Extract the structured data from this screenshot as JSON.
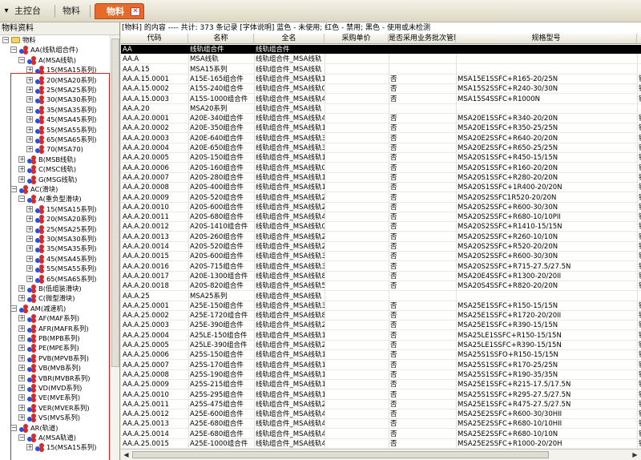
{
  "tabs": {
    "home_label": "主控台",
    "tab2_label": "物料",
    "active_label": "物料",
    "close_glyph": "✕"
  },
  "tree": {
    "header": "物料资料",
    "nodes": [
      {
        "label": "物料",
        "level": 0,
        "exp": "-",
        "icon": "folder"
      },
      {
        "label": "AA(线轨组合件)",
        "level": 1,
        "exp": "-",
        "icon": "cubes"
      },
      {
        "label": "A(MSA线轨)",
        "level": 2,
        "exp": "-",
        "icon": "cubes"
      },
      {
        "label": "15(MSA15系列)",
        "level": 3,
        "exp": "+",
        "icon": "cubes"
      },
      {
        "label": "20(MSA20系列)",
        "level": 3,
        "exp": "+",
        "icon": "cubes"
      },
      {
        "label": "25(MSA25系列)",
        "level": 3,
        "exp": "+",
        "icon": "cubes"
      },
      {
        "label": "30(MSA30系列)",
        "level": 3,
        "exp": "+",
        "icon": "cubes"
      },
      {
        "label": "35(MSA35系列)",
        "level": 3,
        "exp": "+",
        "icon": "cubes"
      },
      {
        "label": "45(MSA45系列)",
        "level": 3,
        "exp": "+",
        "icon": "cubes"
      },
      {
        "label": "55(MSA55系列)",
        "level": 3,
        "exp": "+",
        "icon": "cubes"
      },
      {
        "label": "65(MSA65系列)",
        "level": 3,
        "exp": "+",
        "icon": "cubes"
      },
      {
        "label": "70(MSA70)",
        "level": 3,
        "exp": "+",
        "icon": "cubes"
      },
      {
        "label": "B(MSB线轨)",
        "level": 2,
        "exp": "+",
        "icon": "cubes"
      },
      {
        "label": "C(MSC线轨)",
        "level": 2,
        "exp": "+",
        "icon": "cubes"
      },
      {
        "label": "G(MSG线轨)",
        "level": 2,
        "exp": "+",
        "icon": "cubes"
      },
      {
        "label": "AC(滑块)",
        "level": 1,
        "exp": "-",
        "icon": "cubes"
      },
      {
        "label": "A(重负型滑块)",
        "level": 2,
        "exp": "-",
        "icon": "cubes"
      },
      {
        "label": "15(MSA15系列)",
        "level": 3,
        "exp": "+",
        "icon": "cubes"
      },
      {
        "label": "20(MSA20系列)",
        "level": 3,
        "exp": "+",
        "icon": "cubes"
      },
      {
        "label": "25(MSA25系列)",
        "level": 3,
        "exp": "+",
        "icon": "cubes"
      },
      {
        "label": "30(MSA30系列)",
        "level": 3,
        "exp": "+",
        "icon": "cubes"
      },
      {
        "label": "35(MSA35系列)",
        "level": 3,
        "exp": "+",
        "icon": "cubes"
      },
      {
        "label": "45(MSA45系列)",
        "level": 3,
        "exp": "+",
        "icon": "cubes"
      },
      {
        "label": "55(MSA55系列)",
        "level": 3,
        "exp": "+",
        "icon": "cubes"
      },
      {
        "label": "65(MSA65系列)",
        "level": 3,
        "exp": "+",
        "icon": "cubes"
      },
      {
        "label": "B(低组装滑块)",
        "level": 2,
        "exp": "+",
        "icon": "cubes"
      },
      {
        "label": "C(微型滑块)",
        "level": 2,
        "exp": "+",
        "icon": "cubes"
      },
      {
        "label": "AM(减速机)",
        "level": 1,
        "exp": "-",
        "icon": "cubes"
      },
      {
        "label": "AF(MAF系列)",
        "level": 2,
        "exp": "+",
        "icon": "cubes"
      },
      {
        "label": "AFR(MAFR系列)",
        "level": 2,
        "exp": "+",
        "icon": "cubes"
      },
      {
        "label": "PB(MPB系列)",
        "level": 2,
        "exp": "+",
        "icon": "cubes"
      },
      {
        "label": "PE(MPE系列)",
        "level": 2,
        "exp": "+",
        "icon": "cubes"
      },
      {
        "label": "PVB(MPVB系列)",
        "level": 2,
        "exp": "+",
        "icon": "cubes"
      },
      {
        "label": "VB(MVB系列)",
        "level": 2,
        "exp": "+",
        "icon": "cubes"
      },
      {
        "label": "VBR(MVBR系列)",
        "level": 2,
        "exp": "+",
        "icon": "cubes"
      },
      {
        "label": "VD(MVD系列)",
        "level": 2,
        "exp": "+",
        "icon": "cubes"
      },
      {
        "label": "VE(MVE系列)",
        "level": 2,
        "exp": "+",
        "icon": "cubes"
      },
      {
        "label": "VER(MVER系列)",
        "level": 2,
        "exp": "+",
        "icon": "cubes"
      },
      {
        "label": "VS(MVS系列)",
        "level": 2,
        "exp": "+",
        "icon": "cubes"
      },
      {
        "label": "AR(轨道)",
        "level": 1,
        "exp": "-",
        "icon": "cubes"
      },
      {
        "label": "A(MSA轨道)",
        "level": 2,
        "exp": "-",
        "icon": "cubes"
      },
      {
        "label": "15(MSA15系列)",
        "level": 3,
        "exp": "+",
        "icon": "cubes"
      }
    ]
  },
  "grid": {
    "info": "[物料] 的内容 ---- 共计: 373 条记录 [字体说明] 蓝色 - 未使用; 红色 - 禁用; 黑色 - 使用或未检测",
    "columns": [
      "代码",
      "名称",
      "全名",
      "采购单价",
      "是否采用业务批次管理",
      "规格型号",
      ""
    ],
    "rows": [
      [
        "AA",
        "线轨组合件",
        "线轨组合件",
        "",
        "",
        "",
        ""
      ],
      [
        "AA.A",
        "MSA线轨",
        "线轨组合件_MSA线轨",
        "",
        "",
        "",
        ""
      ],
      [
        "AA.A.15",
        "MSA15系列",
        "线轨组合件_MSA线轨",
        "",
        "",
        "",
        ""
      ],
      [
        "AA.A.15.0001",
        "A15E-165组合件",
        "线轨组合件_MSA线轨109",
        "",
        "否",
        "MSA15E1SSFC+R165-20/25N",
        "银泰"
      ],
      [
        "AA.A.15.0002",
        "A15S-240组合件",
        "线轨组合件_MSA线轨0",
        "",
        "否",
        "MSA15S2SSFC+R240-30/30N",
        "银泰"
      ],
      [
        "AA.A.15.0003",
        "A15S-1000组合件",
        "线轨组合件_MSA线轨493",
        "",
        "否",
        "MSA15S4SSFC+R1000N",
        "银泰"
      ],
      [
        "AA.A.20",
        "MSA20系列",
        "线轨组合件_MSA线轨",
        "",
        "",
        "",
        ""
      ],
      [
        "AA.A.20.0001",
        "A20E-340组合件",
        "线轨组合件_MSA线轨452",
        "",
        "否",
        "MSA20E1SSFC+R340-20/20N",
        "银泰"
      ],
      [
        "AA.A.20.0002",
        "A20E-350组合件",
        "线轨组合件_MSA线轨172",
        "",
        "否",
        "MSA20E1SSFC+R350-25/25N",
        "银泰"
      ],
      [
        "AA.A.20.0003",
        "A20E-640组合件",
        "线轨组合件_MSA线轨330",
        "",
        "否",
        "MSA20E2SSFC+R640-20/20N",
        "银泰"
      ],
      [
        "AA.A.20.0004",
        "A20E-650组合件",
        "线轨组合件_MSA线轨333",
        "",
        "否",
        "MSA20E2SSFC+R650-25/25N",
        "银泰"
      ],
      [
        "AA.A.20.0005",
        "A20S-150组合件",
        "线轨组合件_MSA线轨189",
        "",
        "否",
        "MSA20S1SSFC+R450-15/15N",
        "银泰"
      ],
      [
        "AA.A.20.0006",
        "A20S-160组合件",
        "线轨组合件_MSA线轨0",
        "",
        "否",
        "MSA20S1SSFC+R160-20/20N",
        "银泰"
      ],
      [
        "AA.A.20.0007",
        "A20S-280组合件",
        "线轨组合件_MSA线轨151",
        "",
        "否",
        "MSA20S1SSFC+R280-20/20N",
        "银泰"
      ],
      [
        "AA.A.20.0008",
        "A20S-400组合件",
        "线轨组合件_MSA线轨178",
        "",
        "否",
        "MSA20S1SSFC+1R400-20/20N",
        "银泰"
      ],
      [
        "AA.A.20.0009",
        "A20S-520组合件",
        "线轨组合件_MSA线轨205",
        "",
        "否",
        "MSA20S2SSFC1R520-20/20N",
        "银泰"
      ],
      [
        "AA.A.20.0010",
        "A20S-600组合件",
        "线轨组合件_MSA线轨222",
        "",
        "否",
        "MSA20S2SSFC+R600-30/30N",
        "银泰"
      ],
      [
        "AA.A.20.0011",
        "A20S-680组合件",
        "线轨组合件_MSA线轨431",
        "",
        "否",
        "MSA20S2SSFC+R680-10/10PII",
        "银泰"
      ],
      [
        "AA.A.20.0012",
        "A20S-1410组合件",
        "线轨组合件_MSA线轨0",
        "",
        "否",
        "MSA20S2SSFC+R1410-15/15N",
        "银泰"
      ],
      [
        "AA.A.20.0013",
        "A20S-260组合件",
        "线轨组合件_MSA线轨236",
        "",
        "否",
        "MSA20S2SSFC+R260-10/10N",
        "银泰"
      ],
      [
        "AA.A.20.0014",
        "A20S-520组合件",
        "线轨组合件_MSA线轨294",
        "",
        "否",
        "MSA20S2SSFC+R520-20/20N",
        "银泰"
      ],
      [
        "AA.A.20.0015",
        "A20S-600组合件",
        "线轨组合件_MSA线轨312",
        "",
        "否",
        "MSA20S2SSFC+R600-30/30N",
        "银泰"
      ],
      [
        "AA.A.20.0016",
        "A20S-715组合件",
        "线轨组合件_MSA线轨337",
        "",
        "否",
        "MSA20S2SSFC+R715-27.5/27.5N",
        "银泰"
      ],
      [
        "AA.A.20.0017",
        "A20E-1300组合件",
        "线轨组合件_MSA线轨850",
        "",
        "否",
        "MSA20E4SSFC+R1300-20/20II",
        "银泰"
      ],
      [
        "AA.A.20.0018",
        "A20S-820组合件",
        "线轨组合件_MSA线轨528",
        "",
        "否",
        "MSA20S4SSFC+R820-20/20N",
        "银泰"
      ],
      [
        "AA.A.25",
        "MSA25系列",
        "线轨组合件_MSA线轨",
        "",
        "",
        "",
        ""
      ],
      [
        "AA.A.25.0001",
        "A25E-150组合件",
        "线轨组合件_MSA线轨367",
        "",
        "否",
        "MSA25E1SSFC+R150-15/15N",
        "银泰"
      ],
      [
        "AA.A.25.0002",
        "A25E-1720组合件",
        "线轨组合件_MSA线轨802",
        "",
        "否",
        "MSA25E1SSFC+R1720-20/20II",
        "银泰"
      ],
      [
        "AA.A.25.0003",
        "A25E-390组合件",
        "线轨组合件_MSA线轨214",
        "",
        "否",
        "MSA25E1SSFC+R390-15/15N",
        "银泰"
      ],
      [
        "AA.A.25.0004",
        "A25LE-150组合件",
        "线轨组合件_MSA线轨183",
        "",
        "否",
        "MSA25LE1SSFC+R150-15/15N",
        "银泰"
      ],
      [
        "AA.A.25.0005",
        "A25LE-390组合件",
        "线轨组合件_MSA线轨243",
        "",
        "否",
        "MSA25LE1SSFC+R390-15/15N",
        "银泰"
      ],
      [
        "AA.A.25.0006",
        "A25S-150组合件",
        "线轨组合件_MSA线轨148",
        "",
        "否",
        "MSA25S1SSFO+R150-15/15N",
        "银泰"
      ],
      [
        "AA.A.25.0007",
        "A25S-170组合件",
        "线轨组合件_MSA线轨153",
        "",
        "否",
        "MSA25S1SSFC+R170-25/25N",
        "银泰"
      ],
      [
        "AA.A.25.0008",
        "A25S-190组合件",
        "线轨组合件_MSA线轨158",
        "",
        "否",
        "MSA25S1SSFC+R190-35/35N",
        "银泰"
      ],
      [
        "AA.A.25.0009",
        "A25S-215组合件",
        "线轨组合件_MSA线轨164",
        "",
        "否",
        "MSA25E1SSFC+R215-17.5/17.5N",
        "银泰"
      ],
      [
        "AA.A.25.0010",
        "A25S-295组合件",
        "线轨组合件_MSA线轨184",
        "",
        "否",
        "MSA25S1SSFC+R295-27.5/27.5N",
        "银泰"
      ],
      [
        "AA.A.25.0011",
        "A25S-475组合件",
        "线轨组合件_MSA线轨229",
        "",
        "否",
        "MSA25E1SSFC+R475-27.5/27.5N",
        "银泰"
      ],
      [
        "AA.A.25.0012",
        "A25E-600组合件",
        "线轨组合件_MSA线轨463",
        "",
        "否",
        "MSA25E2SSFC+R600-30/30HII",
        "银泰"
      ],
      [
        "AA.A.25.0013",
        "A25E-680组合件",
        "线轨组合件_MSA线轨487",
        "",
        "否",
        "MSA25E2SSFC+R680-10/10HII",
        "银泰"
      ],
      [
        "AA.A.25.0014",
        "A25E-680组合件",
        "线轨组合件_MSA线轨402",
        "",
        "否",
        "MSA25E2SSFC+R680-10/10N",
        "银泰"
      ],
      [
        "AA.A.25.0015",
        "A25E-1000组合件",
        "线轨组合件_MSA线轨483",
        "",
        "否",
        "MSA25E2SSFC+R1000-20/20H",
        "银泰"
      ]
    ]
  },
  "colors": {
    "active_tab": "#e46b2b",
    "selected_row": "#000000",
    "tree_highlight_frame": "#e02020"
  }
}
